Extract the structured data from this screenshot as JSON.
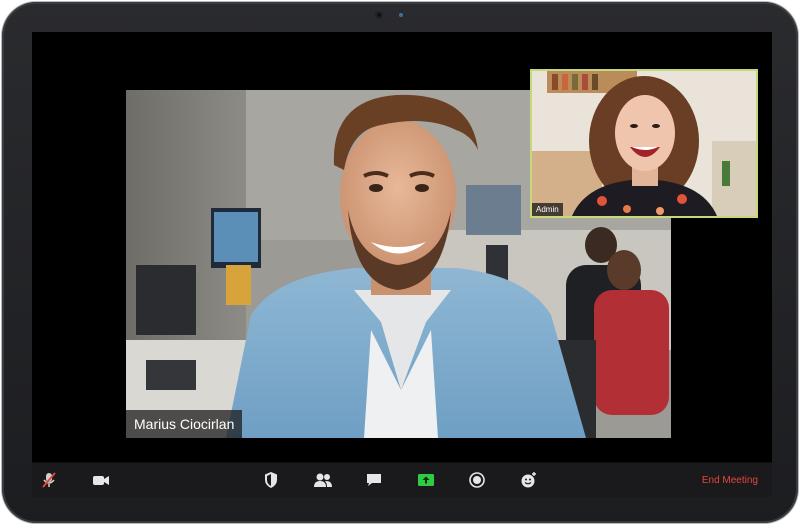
{
  "main_video": {
    "participant_name": "Marius Ciocirlan"
  },
  "pip_video": {
    "participant_name": "Admin",
    "border_color": "#c6d97a"
  },
  "toolbar": {
    "icons": [
      "mic-muted-icon",
      "video-camera-icon",
      "security-shield-icon",
      "participants-icon",
      "chat-icon",
      "share-screen-icon",
      "record-icon",
      "reactions-icon"
    ],
    "share_color": "#2ecc40",
    "end_meeting_label": "End Meeting",
    "end_meeting_color": "#e8453c"
  }
}
